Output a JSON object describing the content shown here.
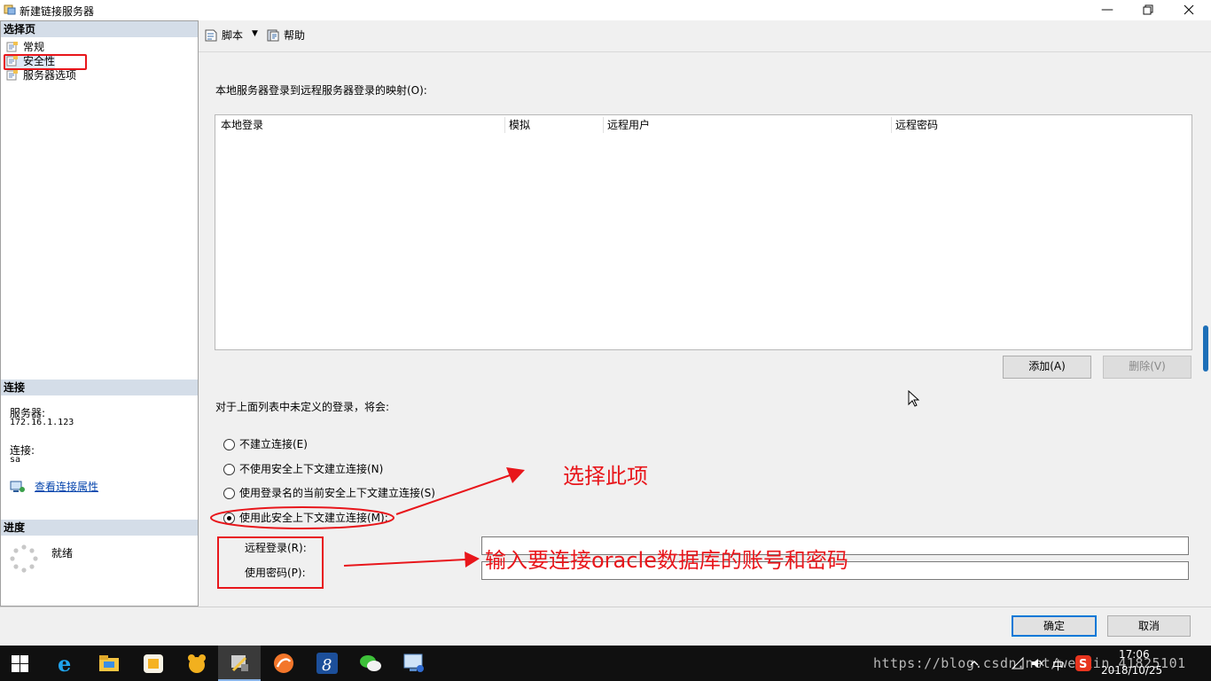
{
  "window": {
    "title": "新建链接服务器"
  },
  "left": {
    "select_page_header": "选择页",
    "nav": [
      {
        "label": "常规"
      },
      {
        "label": "安全性"
      },
      {
        "label": "服务器选项"
      }
    ],
    "connection_header": "连接",
    "server_label": "服务器:",
    "server_value": "172.16.1.123",
    "connection_label": "连接:",
    "connection_value": "sa",
    "view_props_link": "查看连接属性",
    "progress_header": "进度",
    "progress_status": "就绪"
  },
  "toolbar": {
    "script_label": "脚本",
    "help_label": "帮助"
  },
  "main": {
    "mapping_label": "本地服务器登录到远程服务器登录的映射(O):",
    "columns": [
      "本地登录",
      "模拟",
      "远程用户",
      "远程密码"
    ],
    "add_button": "添加(A)",
    "delete_button": "删除(V)",
    "undefined_label": "对于上面列表中未定义的登录，将会:",
    "radios": [
      {
        "label": "不建立连接(E)",
        "selected": false
      },
      {
        "label": "不使用安全上下文建立连接(N)",
        "selected": false
      },
      {
        "label": "使用登录名的当前安全上下文建立连接(S)",
        "selected": false
      },
      {
        "label": "使用此安全上下文建立连接(M):",
        "selected": true
      }
    ],
    "remote_login_label": "远程登录(R):",
    "remote_login_value": "",
    "password_label": "使用密码(P):",
    "password_value": ""
  },
  "annotations": {
    "select_this": "选择此项",
    "enter_account": "输入要连接oracle数据库的账号和密码",
    "color": "#e8161b"
  },
  "footer": {
    "ok_button": "确定",
    "cancel_button": "取消"
  },
  "taskbar": {
    "time": "17:06",
    "date": "2018/10/25",
    "ime": "中",
    "watermark": "https://blog.csdn.net/weixin_41825101"
  }
}
